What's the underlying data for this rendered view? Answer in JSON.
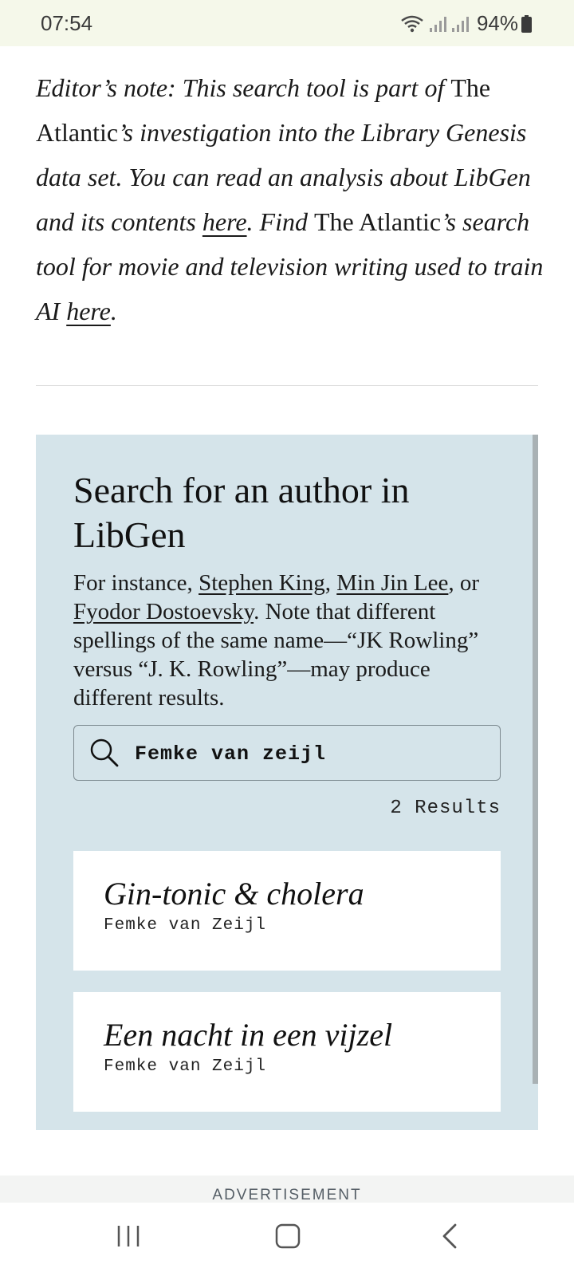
{
  "status": {
    "time": "07:54",
    "battery": "94%",
    "icons": [
      "wifi-icon",
      "signal-icon",
      "signal-icon",
      "battery-icon"
    ]
  },
  "editor_note": {
    "p1": "Editor’s note: This search tool is part of ",
    "pub1": "The Atlantic",
    "p2": "’s investigation into the Library Genesis data set. You can read an analysis about LibGen and its contents ",
    "link1": "here",
    "p3": ". Find ",
    "pub2": "The Atlantic",
    "p4": "’s search tool for movie and television writing used to train AI ",
    "link2": "here",
    "p5": "."
  },
  "search": {
    "title": "Search for an author in LibGen",
    "desc_intro": "For instance, ",
    "example1": "Stephen King",
    "sep1": ", ",
    "example2": "Min Jin Lee",
    "sep2": ", or ",
    "example3": "Fyodor Dostoevsky",
    "desc_rest": ". Note that different spellings of the same name—“JK Rowling” versus “J. K. Rowling”—may produce different results.",
    "input_value": "Femke van zeijl",
    "results_count": "2 Results"
  },
  "results": [
    {
      "title": "Gin-tonic & cholera",
      "author": "Femke van Zeijl"
    },
    {
      "title": "Een nacht in een vijzel",
      "author": "Femke van Zeijl"
    }
  ],
  "ad_label": "ADVERTISEMENT",
  "nav": {
    "icons": [
      "recent-apps-icon",
      "home-icon",
      "back-icon"
    ]
  }
}
